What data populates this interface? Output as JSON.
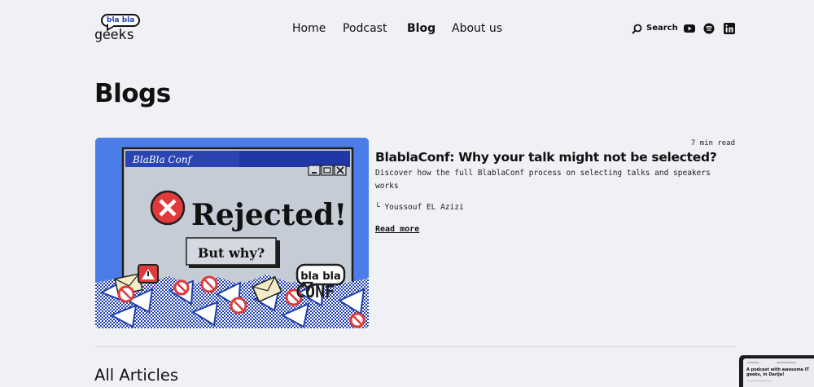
{
  "header": {
    "logo": {
      "bubble": "bla bla",
      "word": "geeks"
    },
    "nav": [
      {
        "label": "Home",
        "active": false
      },
      {
        "label": "Podcast",
        "active": false
      },
      {
        "label": "Blog",
        "active": true
      },
      {
        "label": "About us",
        "active": false
      }
    ],
    "search_label": "Search",
    "social_icons": [
      "youtube-icon",
      "spotify-icon",
      "linkedin-icon"
    ]
  },
  "page": {
    "title": "Blogs"
  },
  "featured": {
    "image": {
      "window_title": "BlaBla Conf",
      "headline": "Rejected!",
      "button": "But why?",
      "badge": "bla bla",
      "badge_sub": "CONF"
    },
    "read_time": "7 min read",
    "title": "BlablaConf: Why your talk might not be selected?",
    "description": "Discover how the full BlablaConf process on selecting talks and speakers works",
    "author": "└ Youssouf EL Azizi",
    "read_more": "Read more"
  },
  "all_articles": {
    "title": "All Articles"
  },
  "thumbnail": {
    "text": "A podcast with awesome IT geeks, in Darija!"
  },
  "colors": {
    "background": "#f0f1f5",
    "accent_blue": "#4a7de8",
    "window_gray": "#c6ccd6",
    "error_red": "#e03a3a"
  }
}
